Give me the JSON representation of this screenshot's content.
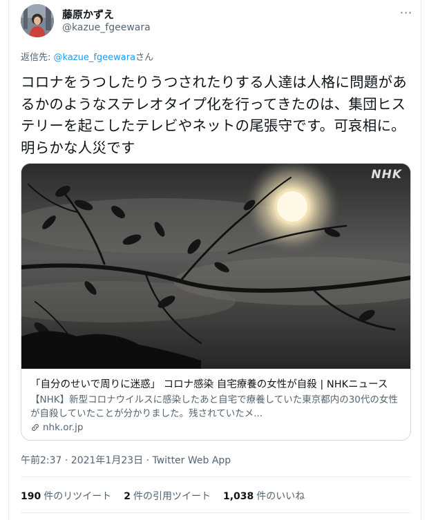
{
  "user": {
    "display_name": "藤原かずえ",
    "handle": "@kazue_fgeewara"
  },
  "reply": {
    "prefix": "返信先: ",
    "mention": "@kazue_fgeewara",
    "suffix": "さん"
  },
  "tweet": {
    "text": "コロナをうつしたりうつされたりする人達は人格に問題があるかのようなステレオタイプ化を行ってきたのは、集団ヒステリーを起こしたテレビやネットの尾張守です。可哀相に。明らかな人災です"
  },
  "card": {
    "image_watermark": "NHK",
    "title": "「自分のせいで周りに迷惑」 コロナ感染 自宅療養の女性が自殺 | NHKニュース",
    "description": "【NHK】新型コロナウイルスに感染したあと自宅で療養していた東京都内の30代の女性が自殺していたことが分かりました。残されていたメ...",
    "domain": "nhk.or.jp"
  },
  "meta": {
    "timestamp": "午前2:37 · 2021年1月23日",
    "separator": " · ",
    "source": "Twitter Web App"
  },
  "stats": {
    "retweets_count": "190",
    "retweets_label": "件のリツイート",
    "quotes_count": "2",
    "quotes_label": "件の引用ツイート",
    "likes_count": "1,038",
    "likes_label": "件のいいね"
  },
  "more_label": "···"
}
